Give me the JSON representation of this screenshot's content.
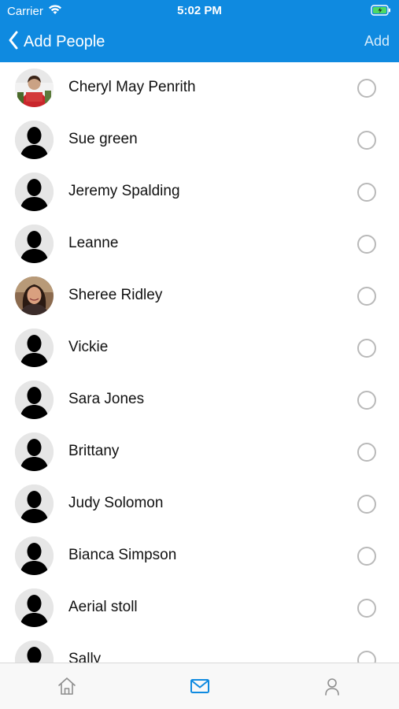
{
  "status_bar": {
    "carrier": "Carrier",
    "time": "5:02 PM"
  },
  "nav": {
    "back_title": "Add People",
    "add_label": "Add"
  },
  "colors": {
    "accent": "#0f8ae0",
    "radio_border": "#b9b9b9",
    "tab_active": "#0f8ae0",
    "tab_inactive": "#8e8e8e"
  },
  "contacts": [
    {
      "name": "Cheryl May Penrith",
      "avatar": "photo-red",
      "selected": false
    },
    {
      "name": "Sue green",
      "avatar": "silhouette",
      "selected": false
    },
    {
      "name": "Jeremy Spalding",
      "avatar": "silhouette",
      "selected": false
    },
    {
      "name": "Leanne",
      "avatar": "silhouette",
      "selected": false
    },
    {
      "name": "Sheree Ridley",
      "avatar": "photo-woman",
      "selected": false
    },
    {
      "name": "Vickie",
      "avatar": "silhouette",
      "selected": false
    },
    {
      "name": "Sara Jones",
      "avatar": "silhouette",
      "selected": false
    },
    {
      "name": "Brittany",
      "avatar": "silhouette",
      "selected": false
    },
    {
      "name": "Judy Solomon",
      "avatar": "silhouette",
      "selected": false
    },
    {
      "name": "Bianca Simpson",
      "avatar": "silhouette",
      "selected": false
    },
    {
      "name": "Aerial stoll",
      "avatar": "silhouette",
      "selected": false
    },
    {
      "name": "Sally",
      "avatar": "silhouette",
      "selected": false
    }
  ],
  "tabs": [
    {
      "icon": "home-icon",
      "active": false
    },
    {
      "icon": "mail-icon",
      "active": true
    },
    {
      "icon": "user-icon",
      "active": false
    }
  ]
}
